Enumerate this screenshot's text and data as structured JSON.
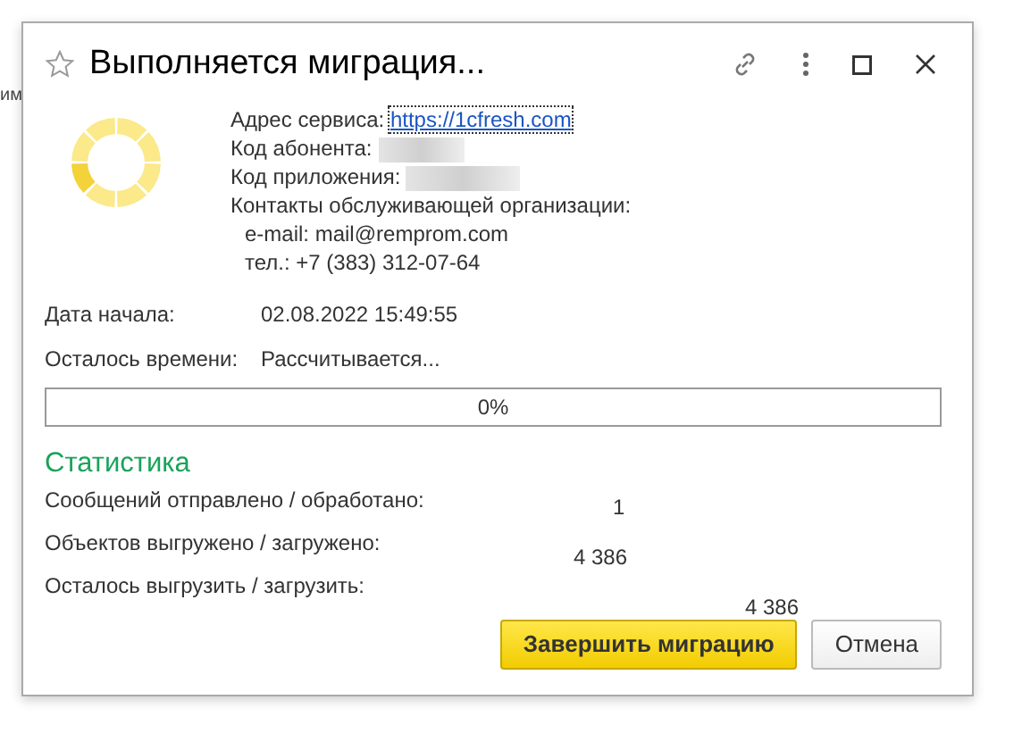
{
  "background_text": "им",
  "window": {
    "title": "Выполняется миграция..."
  },
  "info": {
    "service_label": "Адрес сервиса:",
    "service_link": "https://1cfresh.com",
    "subscriber_label": "Код абонента:",
    "app_label": "Код приложения:",
    "contacts_label": "Контакты обслуживающей организации:",
    "email": "e-mail: mail@remprom.com",
    "phone": "тел.: +7 (383) 312-07-64"
  },
  "fields": [
    {
      "label": "Дата начала:",
      "value": "02.08.2022 15:49:55"
    },
    {
      "label": "Осталось времени:",
      "value": "Рассчитывается..."
    }
  ],
  "progress": {
    "level": 0,
    "reading": "0%"
  },
  "statistics": {
    "title": "Статистика",
    "rows": [
      {
        "label": "Сообщений отправлено / обработано:",
        "value": "1"
      },
      {
        "label": "Объектов выгружено / загружено:",
        "value": "4 386"
      },
      {
        "label": "Осталось выгрузить / загрузить:",
        "value": "4 386"
      }
    ]
  },
  "buttons": [
    {
      "label": "Завершить миграцию",
      "kind": "primary"
    },
    {
      "label": "Отмена",
      "kind": "secondary"
    }
  ]
}
